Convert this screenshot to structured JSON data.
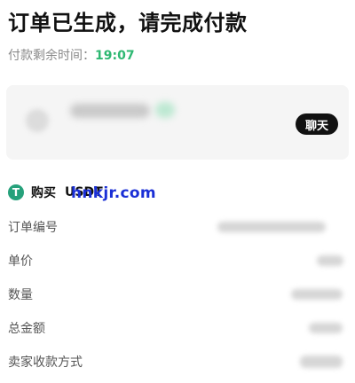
{
  "header": {
    "title": "订单已生成，请完成付款",
    "countdown_label": "付款剩余时间：",
    "countdown_value": "19:07"
  },
  "merchant": {
    "chat_label": "聊天"
  },
  "order": {
    "buy_label": "购买",
    "coin": "USDT",
    "coin_icon": "T",
    "watermark": "hnkjr.com"
  },
  "details": {
    "order_no_label": "订单编号",
    "unit_price_label": "单价",
    "quantity_label": "数量",
    "total_label": "总金额",
    "payment_method_label": "卖家收款方式"
  },
  "colors": {
    "accent_green": "#2eb872",
    "usdt_green": "#26a17b",
    "watermark_blue": "#1a2fd6"
  }
}
